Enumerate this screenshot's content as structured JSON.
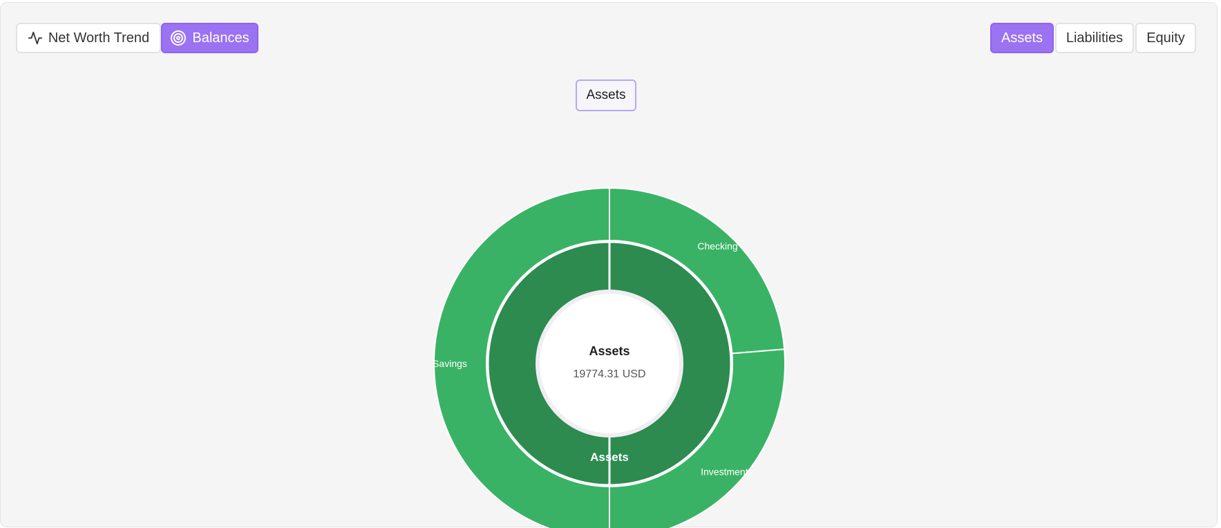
{
  "toolbar": {
    "net_worth_trend_label": "Net Worth Trend",
    "balances_label": "Balances",
    "active_view": "Balances",
    "net_worth_icon": "activity-icon",
    "balances_icon": "target-icon"
  },
  "account_tabs": {
    "assets_label": "Assets",
    "liabilities_label": "Liabilities",
    "equity_label": "Equity",
    "active_tab": "Assets"
  },
  "colors": {
    "accent": "#9b72f2",
    "inner_ring": "#2d8b50",
    "outer_ring": "#3ab265"
  },
  "chart_data": {
    "type": "sunburst",
    "title": "Assets",
    "center_label": "Assets",
    "center_value": "19774.31 USD",
    "total": 19774.31,
    "unit": "USD",
    "inner_ring": [
      {
        "name": "Assets",
        "share": 1.0
      }
    ],
    "outer_ring": [
      {
        "name": "Checking",
        "share": 0.237
      },
      {
        "name": "Investments",
        "share": 0.263
      },
      {
        "name": "Savings",
        "share": 0.5
      }
    ]
  }
}
